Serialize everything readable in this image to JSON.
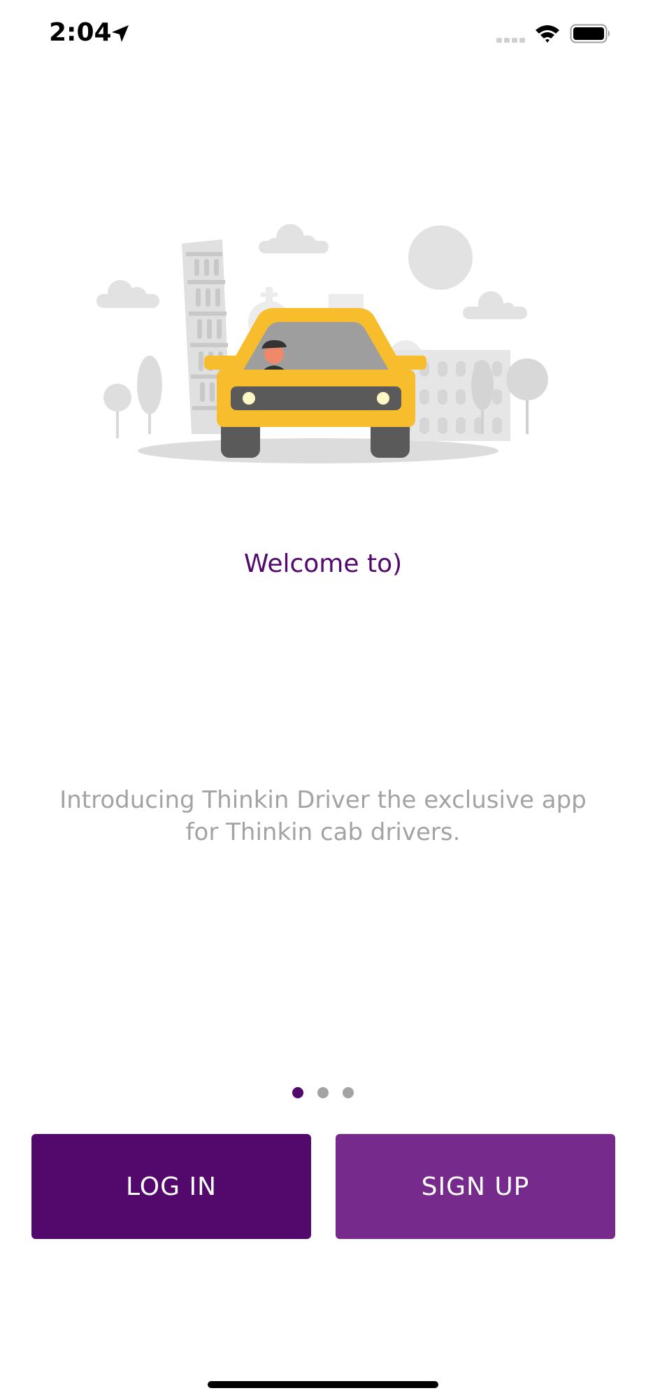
{
  "status_bar": {
    "time": "2:04",
    "icons": [
      "location-arrow-icon",
      "signal-icon",
      "wifi-icon",
      "battery-icon"
    ]
  },
  "hero": {
    "illustration": "taxi-city-illustration",
    "colors": {
      "car": "#F7BD2C",
      "landmarks": "#DCDCDC"
    }
  },
  "onboarding": {
    "title": "Welcome to)",
    "description": "Introducing Thinkin Driver the exclusive app for Thinkin cab drivers.",
    "page_count": 3,
    "current_page": 1
  },
  "actions": {
    "login_label": "LOG IN",
    "signup_label": "SIGN UP"
  },
  "colors": {
    "primary": "#52096B",
    "secondary": "#762A8C",
    "muted_text": "#A3A3A3"
  }
}
